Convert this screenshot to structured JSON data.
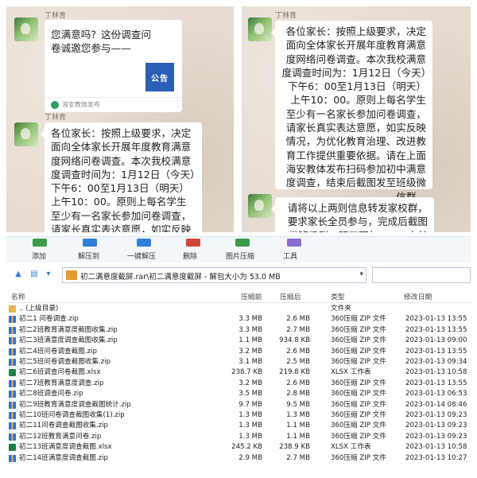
{
  "chat_left": {
    "sender_1": "丁林青",
    "card": {
      "text": "您满意吗？这份调查问卷诚邀您参与——",
      "thumb_label": "公告",
      "source": "海安教体发布"
    },
    "sender_2": "丁林青",
    "message": "各位家长：按照上级要求，决定面向全体家长开展年度教育满意度网络问卷调查。本次我校满意度调查时间为：1月12日（今天）下午6：00至1月13日（明天）上午10：00。原则上每名学生至少有一名家长参加问卷调查，请家长真实表达意愿，如实反映情况，为优化教育治理，改进教育工作提供重要依"
  },
  "chat_right": {
    "sender_1": "丁林青",
    "message_1": "各位家长：按照上级要求，决定面向全体家长开展年度教育满意度网络问卷调查。本次我校满意度调查时间为：1月12日（今天）下午6：00至1月13日（明天）上午10：00。原则上每名学生至少有一名家长参加问卷调查，请家长真实表达意愿，如实反映情况，为优化教育治理、改进教育工作提供重要依据。请在上面海安教体发布扫码参加初中满意度调查，结束后截图发至班级微信群。",
    "message_2": "请将以上两则信息转发家校群，要求家长全员参与，完成后截图发班级群，明天下午6：00之前打包发"
  },
  "toolbar": {
    "buttons": [
      "添加",
      "解压到",
      "一键解压",
      "删除",
      "图片压缩",
      "工具"
    ],
    "colors": [
      "#3a9a4a",
      "#2f7fd8",
      "#2f7fd8",
      "#d2473b",
      "#3a9a4a",
      "#8a6bd0"
    ]
  },
  "address": {
    "path": "初二满意度截屏.rar\\初二满意度截屏 - 解包大小为 53.0 MB"
  },
  "columns": {
    "name": "名称",
    "compressed": "压缩前",
    "size": "压缩后",
    "type": "类型",
    "modified": "修改日期"
  },
  "files": [
    {
      "name": ".. (上级目录)",
      "compressed": "",
      "size": "",
      "type": "文件夹",
      "modified": "",
      "icon": "up"
    },
    {
      "name": "初二1 问卷调查.zip",
      "compressed": "3.3 MB",
      "size": "2.6 MB",
      "type": "360压缩 ZIP 文件",
      "modified": "2023-01-13 13:55",
      "icon": "zip"
    },
    {
      "name": "初二2班教育满意度截图收集.zip",
      "compressed": "3.3 MB",
      "size": "2.7 MB",
      "type": "360压缩 ZIP 文件",
      "modified": "2023-01-13 13:55",
      "icon": "zip"
    },
    {
      "name": "初二3班满意度调查截图收集.zip",
      "compressed": "1.1 MB",
      "size": "934.8 KB",
      "type": "360压缩 ZIP 文件",
      "modified": "2023-01-13 09:00",
      "icon": "zip"
    },
    {
      "name": "初二4班问卷调查截图.zip",
      "compressed": "3.2 MB",
      "size": "2.6 MB",
      "type": "360压缩 ZIP 文件",
      "modified": "2023-01-13 13:55",
      "icon": "zip"
    },
    {
      "name": "初二5班问卷调查截图收集.zip",
      "compressed": "3.1 MB",
      "size": "2.5 MB",
      "type": "360压缩 ZIP 文件",
      "modified": "2023-01-13 09:34",
      "icon": "zip"
    },
    {
      "name": "初二6班调查问卷截图.xlsx",
      "compressed": "238.7 KB",
      "size": "219.8 KB",
      "type": "XLSX 工作表",
      "modified": "2023-01-13 10:58",
      "icon": "xlsx"
    },
    {
      "name": "初二7班教育满意度调查.zip",
      "compressed": "3.2 MB",
      "size": "2.6 MB",
      "type": "360压缩 ZIP 文件",
      "modified": "2023-01-13 13:55",
      "icon": "zip"
    },
    {
      "name": "初二8班调查问卷.zip",
      "compressed": "3.5 MB",
      "size": "2.8 MB",
      "type": "360压缩 ZIP 文件",
      "modified": "2023-01-13 06:53",
      "icon": "zip"
    },
    {
      "name": "初二9班教育满意度调查截图统计.zip",
      "compressed": "9.7 MB",
      "size": "9.5 MB",
      "type": "360压缩 ZIP 文件",
      "modified": "2023-01-14 08:46",
      "icon": "zip"
    },
    {
      "name": "初二10班问卷调查截图收集(1).zip",
      "compressed": "1.3 MB",
      "size": "1.3 MB",
      "type": "360压缩 ZIP 文件",
      "modified": "2023-01-13 09:23",
      "icon": "zip"
    },
    {
      "name": "初二11问卷调查截图收集.zip",
      "compressed": "1.3 MB",
      "size": "1.1 MB",
      "type": "360压缩 ZIP 文件",
      "modified": "2023-01-13 09:23",
      "icon": "zip"
    },
    {
      "name": "初二12班教育满意问卷.zip",
      "compressed": "1.3 MB",
      "size": "1.1 MB",
      "type": "360压缩 ZIP 文件",
      "modified": "2023-01-13 09:23",
      "icon": "zip"
    },
    {
      "name": "初二13班满意度调查截图.xlsx",
      "compressed": "245.2 KB",
      "size": "238.9 KB",
      "type": "XLSX 工作表",
      "modified": "2023-01-13 10:58",
      "icon": "xlsx"
    },
    {
      "name": "初二14班满意度调查截图.zip",
      "compressed": "2.9 MB",
      "size": "2.7 MB",
      "type": "360压缩 ZIP 文件",
      "modified": "2023-01-13 10:27",
      "icon": "zip"
    }
  ]
}
